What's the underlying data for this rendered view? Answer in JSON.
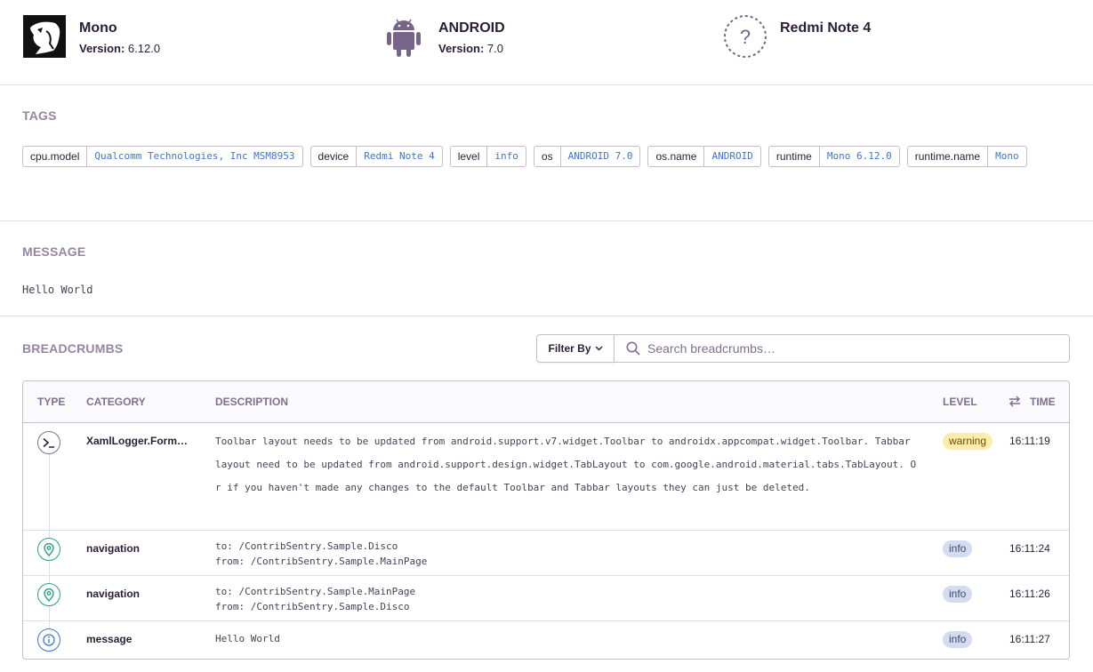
{
  "context": {
    "runtime": {
      "name": "Mono",
      "version_label": "Version:",
      "version": "6.12.0",
      "icon": "mono-logo-icon"
    },
    "os": {
      "name": "ANDROID",
      "version_label": "Version:",
      "version": "7.0",
      "icon": "android-icon"
    },
    "device": {
      "name": "Redmi Note 4",
      "icon": "unknown-device-icon"
    }
  },
  "tags": {
    "title": "TAGS",
    "items": [
      {
        "key": "cpu.model",
        "value": "Qualcomm Technologies, Inc MSM8953"
      },
      {
        "key": "device",
        "value": "Redmi Note 4"
      },
      {
        "key": "level",
        "value": "info"
      },
      {
        "key": "os",
        "value": "ANDROID 7.0"
      },
      {
        "key": "os.name",
        "value": "ANDROID"
      },
      {
        "key": "runtime",
        "value": "Mono 6.12.0"
      },
      {
        "key": "runtime.name",
        "value": "Mono"
      }
    ]
  },
  "message": {
    "title": "MESSAGE",
    "text": "Hello World"
  },
  "breadcrumbs": {
    "title": "BREADCRUMBS",
    "filter_label": "Filter By",
    "search_placeholder": "Search breadcrumbs…",
    "columns": {
      "type": "TYPE",
      "category": "CATEGORY",
      "description": "DESCRIPTION",
      "level": "LEVEL",
      "time": "TIME"
    },
    "rows": [
      {
        "type_icon": "terminal-icon",
        "category": "XamlLogger.Form…",
        "description": "Toolbar layout needs to be updated from android.support.v7.widget.Toolbar to androidx.appcompat.widget.Toolbar. Tabbar layout need to be updated from android.support.design.widget.TabLayout to com.google.android.material.tabs.TabLayout. Or if you haven't made any changes to the default Toolbar and Tabbar layouts they can just be deleted.",
        "level": "warning",
        "time": "16:11:19"
      },
      {
        "type_icon": "location-pin-icon",
        "category": "navigation",
        "to": "to: /ContribSentry.Sample.Disco",
        "from": "from: /ContribSentry.Sample.MainPage",
        "level": "info",
        "time": "16:11:24"
      },
      {
        "type_icon": "location-pin-icon",
        "category": "navigation",
        "to": "to: /ContribSentry.Sample.MainPage",
        "from": "from: /ContribSentry.Sample.Disco",
        "level": "info",
        "time": "16:11:26"
      },
      {
        "type_icon": "info-circle-icon",
        "category": "message",
        "description": "Hello World",
        "level": "info",
        "time": "16:11:27"
      }
    ]
  },
  "colors": {
    "tag_value": "#3d74db",
    "warning_badge": "#ffebab",
    "info_badge": "#d5dcf0",
    "nav_icon": "#2ba185",
    "info_icon": "#3d74db"
  }
}
